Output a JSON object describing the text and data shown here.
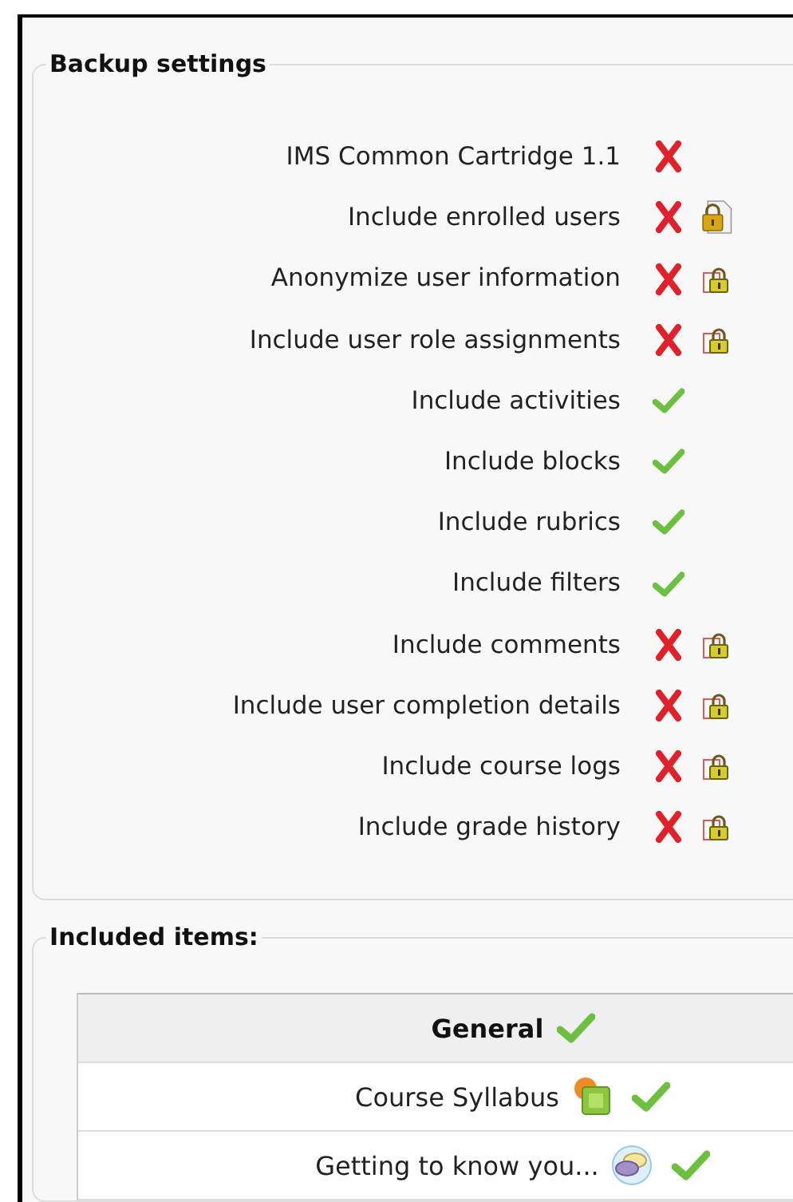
{
  "backup_settings": {
    "title": "Backup settings",
    "settings": [
      {
        "label": "IMS Common Cartridge 1.1",
        "included": false,
        "kind": "plain"
      },
      {
        "label": "Include enrolled users",
        "included": false,
        "kind": "document"
      },
      {
        "label": "Anonymize user information",
        "included": false,
        "kind": "locked"
      },
      {
        "label": "Include user role assignments",
        "included": false,
        "kind": "locked"
      },
      {
        "label": "Include activities",
        "included": true,
        "kind": "plain"
      },
      {
        "label": "Include blocks",
        "included": true,
        "kind": "plain"
      },
      {
        "label": "Include rubrics",
        "included": true,
        "kind": "plain"
      },
      {
        "label": "Include filters",
        "included": true,
        "kind": "plain"
      },
      {
        "label": "Include comments",
        "included": false,
        "kind": "locked"
      },
      {
        "label": "Include user completion details",
        "included": false,
        "kind": "locked"
      },
      {
        "label": "Include course logs",
        "included": false,
        "kind": "locked"
      },
      {
        "label": "Include grade history",
        "included": false,
        "kind": "locked"
      }
    ]
  },
  "included_items": {
    "title": "Included items:",
    "section": {
      "name": "General",
      "included": true
    },
    "items": [
      {
        "name": "Course Syllabus",
        "kind": "resource",
        "included": true
      },
      {
        "name": "Getting to know you...",
        "kind": "forum",
        "included": true
      }
    ]
  }
}
